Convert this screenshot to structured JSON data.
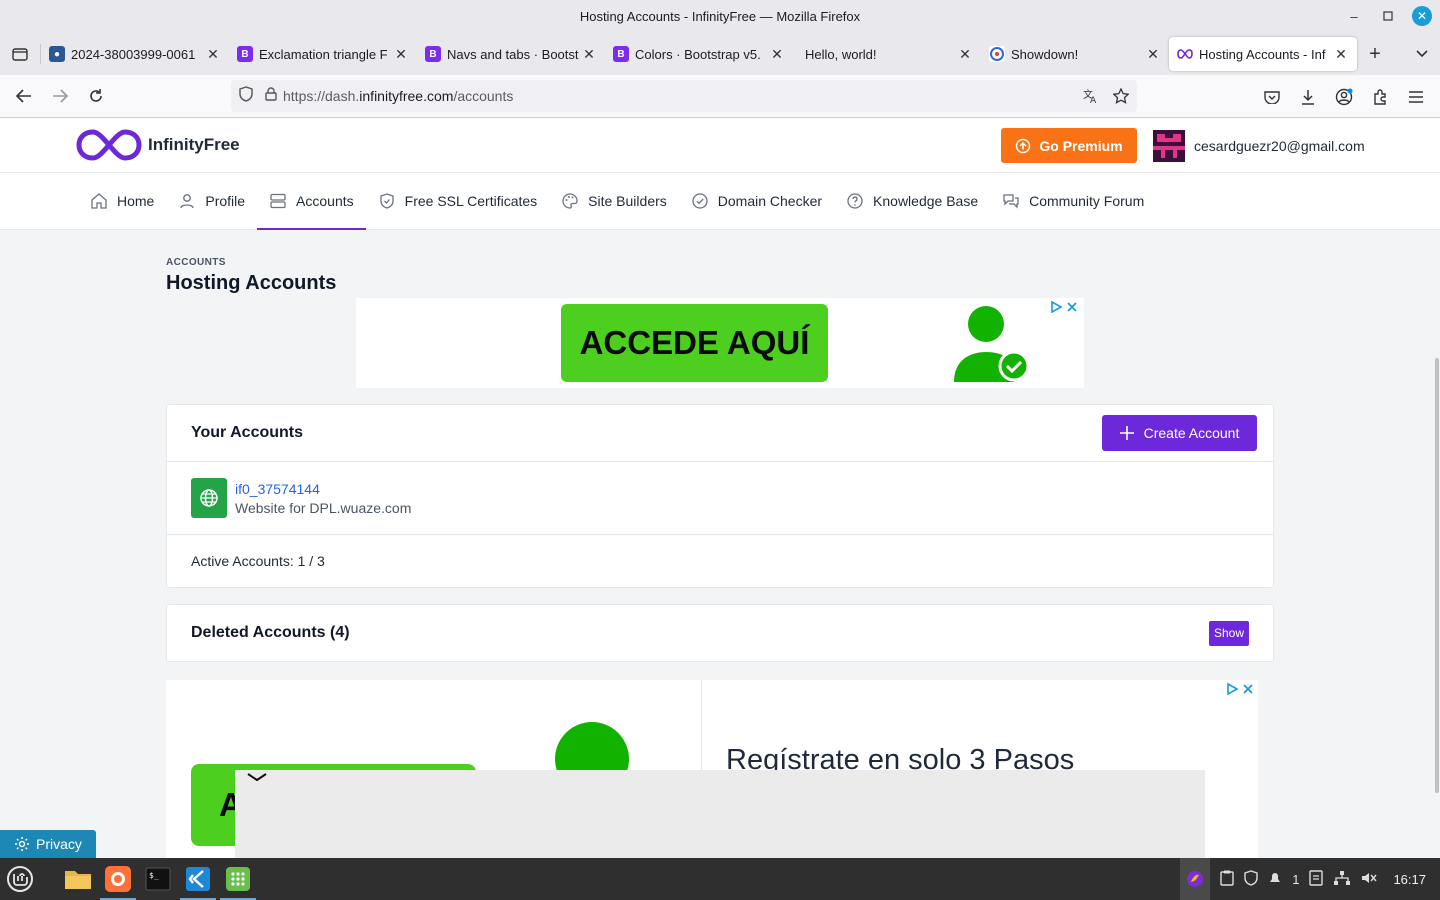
{
  "window": {
    "title": "Hosting Accounts - InfinityFree — Mozilla Firefox"
  },
  "tabs": [
    {
      "label": "2024-38003999-0061",
      "favicon_color": "#2b5797"
    },
    {
      "label": "Exclamation triangle F",
      "favicon_color": "#7a2cf0",
      "favicon_letter": "B"
    },
    {
      "label": "Navs and tabs · Bootst",
      "favicon_color": "#7a2cf0",
      "favicon_letter": "B"
    },
    {
      "label": "Colors · Bootstrap v5.",
      "favicon_color": "#7a2cf0",
      "favicon_letter": "B"
    },
    {
      "label": "Hello, world!"
    },
    {
      "label": "Showdown!"
    },
    {
      "label": "Hosting Accounts - Inf",
      "active": true
    }
  ],
  "urlbar": {
    "prefix": "https://dash.",
    "domain": "infinityfree.com",
    "path": "/accounts"
  },
  "site": {
    "logo_text": "InfinityFree",
    "premium_label": "Go Premium",
    "user_email": "cesardguezr20@gmail.com"
  },
  "nav": [
    {
      "label": "Home",
      "icon": "home-icon"
    },
    {
      "label": "Profile",
      "icon": "user-icon"
    },
    {
      "label": "Accounts",
      "icon": "server-icon",
      "active": true
    },
    {
      "label": "Free SSL Certificates",
      "icon": "shield-icon"
    },
    {
      "label": "Site Builders",
      "icon": "palette-icon"
    },
    {
      "label": "Domain Checker",
      "icon": "check-circle-icon"
    },
    {
      "label": "Knowledge Base",
      "icon": "question-icon"
    },
    {
      "label": "Community Forum",
      "icon": "chat-icon"
    }
  ],
  "page": {
    "breadcrumb": "ACCOUNTS",
    "title": "Hosting Accounts"
  },
  "ad_top": {
    "button_text": "ACCEDE AQUÍ"
  },
  "accounts_card": {
    "title": "Your Accounts",
    "create_label": "Create Account",
    "accounts": [
      {
        "id": "if0_37574144",
        "description": "Website for DPL.wuaze.com"
      }
    ],
    "active_count": "Active Accounts: 1 / 3"
  },
  "deleted_card": {
    "title": "Deleted Accounts (4)",
    "show_label": "Show"
  },
  "ad_bottom": {
    "button_text": "A",
    "headline": "Regístrate en solo 3 Pasos"
  },
  "privacy_label": "Privacy",
  "taskbar": {
    "time": "16:17",
    "notif_count": "1"
  },
  "colors": {
    "accent": "#6d28d9",
    "premium": "#f97316",
    "ad_green": "#4ccf1e"
  }
}
